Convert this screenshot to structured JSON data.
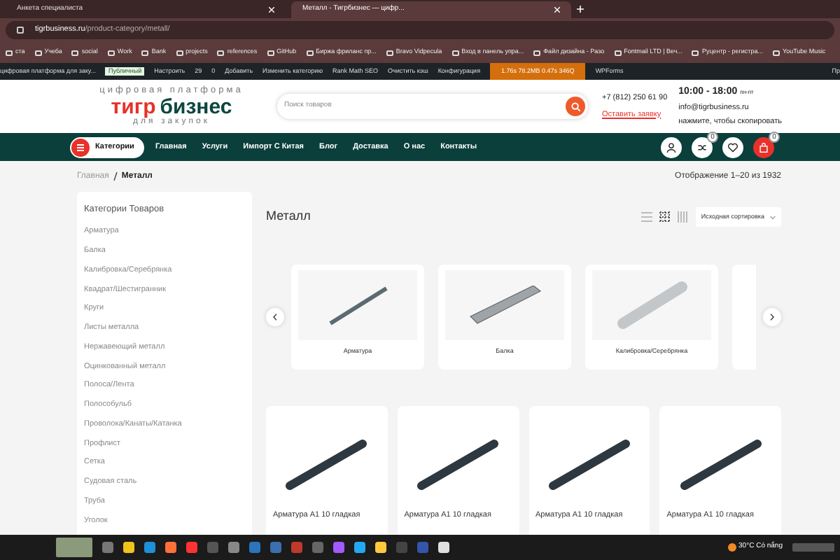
{
  "browser": {
    "tabs": [
      {
        "title": "Анкета специалиста",
        "selected": false
      },
      {
        "title": "Металл - Тигрбизнес — цифр...",
        "selected": true
      }
    ],
    "url_host": "tigrbusiness.ru",
    "url_path": "/product-category/metall/",
    "bookmarks": [
      "ста",
      "Учеба",
      "social",
      "Work",
      "Bank",
      "projects",
      "references",
      "GitHub",
      "Биржа фриланс пр...",
      "Bravo Vidpecula",
      "Вход в панель упра...",
      "Файл дизайна - Pазо",
      "Fontmail LTD | Веч...",
      "Руцентр - регистра...",
      "YouTube Music"
    ]
  },
  "admin_bar": {
    "site": "цифровая платформа для заку...",
    "badge": "Публичный",
    "items": [
      "Настроить",
      "29",
      "0",
      "Добавить",
      "Изменить категорию",
      "Rank Math SEO",
      "Очистить кэш",
      "Конфигурация"
    ],
    "stats": "1.76s  78.2MB  0.47s  346Q",
    "plugin": "WPForms",
    "cut": "Пр"
  },
  "header": {
    "logo_top": "цифровая платформа",
    "logo_left": "тигр",
    "logo_right": "бизнес",
    "logo_bottom": "для закупок",
    "search_placeholder": "Поиск товаров",
    "phone": "+7 (812) 250 61 90",
    "callback": "Оставить заявку",
    "hours": "10:00 - 18:00",
    "hours_suffix": "пн-пт",
    "email": "info@tigrbusiness.ru",
    "copy_hint": "нажмите, чтобы скопировать"
  },
  "nav": {
    "categories": "Категории",
    "links": [
      "Главная",
      "Услуги",
      "Импорт С Китая",
      "Блог",
      "Доставка",
      "О нас",
      "Контакты"
    ],
    "compare_count": "0",
    "cart_count": "0"
  },
  "breadcrumb": [
    "Главная",
    "Металл"
  ],
  "result_count": "Отображение 1–20 из 1932",
  "sidebar": {
    "title": "Категории Товаров",
    "items": [
      "Арматура",
      "Балка",
      "Калибровка/Серебрянка",
      "Квадрат/Шестигранник",
      "Круги",
      "Листы металла",
      "Нержавеющий металл",
      "Оцинкованный металл",
      "Полоса/Лента",
      "Полособульб",
      "Проволока/Канаты/Катанка",
      "Профлист",
      "Сетка",
      "Судовая сталь",
      "Труба",
      "Уголок"
    ]
  },
  "page_title": "Металл",
  "views": [
    {
      "kind": "list",
      "selected": false
    },
    {
      "kind": "grid3",
      "selected": true
    },
    {
      "kind": "grid4",
      "selected": false
    }
  ],
  "sort": "Исходная сортировка",
  "category_cards": [
    {
      "kind": "rebar",
      "label": "Арматура"
    },
    {
      "kind": "channel",
      "label": "Балка"
    },
    {
      "kind": "rod",
      "label": "Калибровка/Серебрянка"
    }
  ],
  "products": [
    "Арматура А1 10 гладкая",
    "Арматура А1 10 гладкая",
    "Арматура А1 10 гладкая",
    "Арматура А1 10 гладкая"
  ],
  "taskbar": {
    "weather": "30°C  Có nắng"
  }
}
